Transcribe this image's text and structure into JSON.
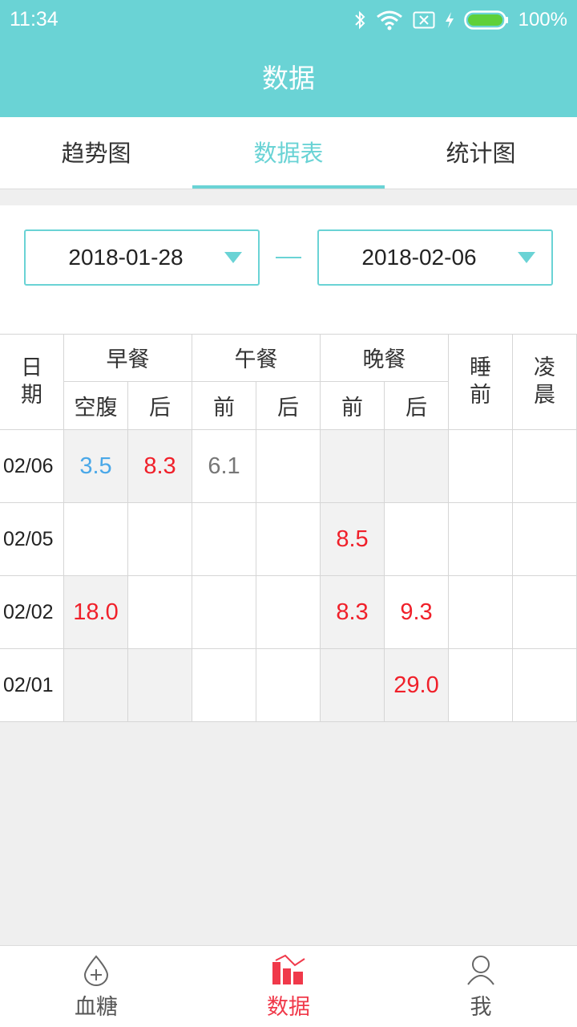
{
  "status_bar": {
    "time": "11:34",
    "battery": "100%",
    "icons": [
      "bluetooth-icon",
      "wifi-icon",
      "no-sim-icon",
      "charging-icon",
      "battery-icon"
    ]
  },
  "header": {
    "title": "数据"
  },
  "tabs": [
    {
      "label": "趋势图",
      "active": false
    },
    {
      "label": "数据表",
      "active": true
    },
    {
      "label": "统计图",
      "active": false
    }
  ],
  "date_range": {
    "start": "2018-01-28",
    "end": "2018-02-06"
  },
  "table": {
    "date_header": [
      "日",
      "期"
    ],
    "groups": [
      "早餐",
      "午餐",
      "晚餐"
    ],
    "sub_headers": [
      "空腹",
      "后",
      "前",
      "后",
      "前",
      "后"
    ],
    "sleep_header": [
      "睡",
      "前"
    ],
    "early_header": [
      "凌",
      "晨"
    ],
    "rows": [
      {
        "date": "02/06",
        "values": [
          "3.5",
          "8.3",
          "6.1",
          "",
          "",
          "",
          "",
          ""
        ]
      },
      {
        "date": "02/05",
        "values": [
          "",
          "",
          "",
          "",
          "8.5",
          "",
          "",
          ""
        ]
      },
      {
        "date": "02/02",
        "values": [
          "18.0",
          "",
          "",
          "",
          "8.3",
          "9.3",
          "",
          ""
        ]
      },
      {
        "date": "02/01",
        "values": [
          "",
          "",
          "",
          "",
          "",
          "29.0",
          "",
          ""
        ]
      }
    ]
  },
  "colors": {
    "accent": "#6ad3d5",
    "high": "#f0202a",
    "low": "#4aa8e8",
    "normal": "#777777",
    "nav_active": "#f0394a"
  },
  "bottom_nav": [
    {
      "label": "血糖",
      "icon": "blood-drop-icon",
      "active": false
    },
    {
      "label": "数据",
      "icon": "bar-chart-icon",
      "active": true
    },
    {
      "label": "我",
      "icon": "person-icon",
      "active": false
    }
  ]
}
